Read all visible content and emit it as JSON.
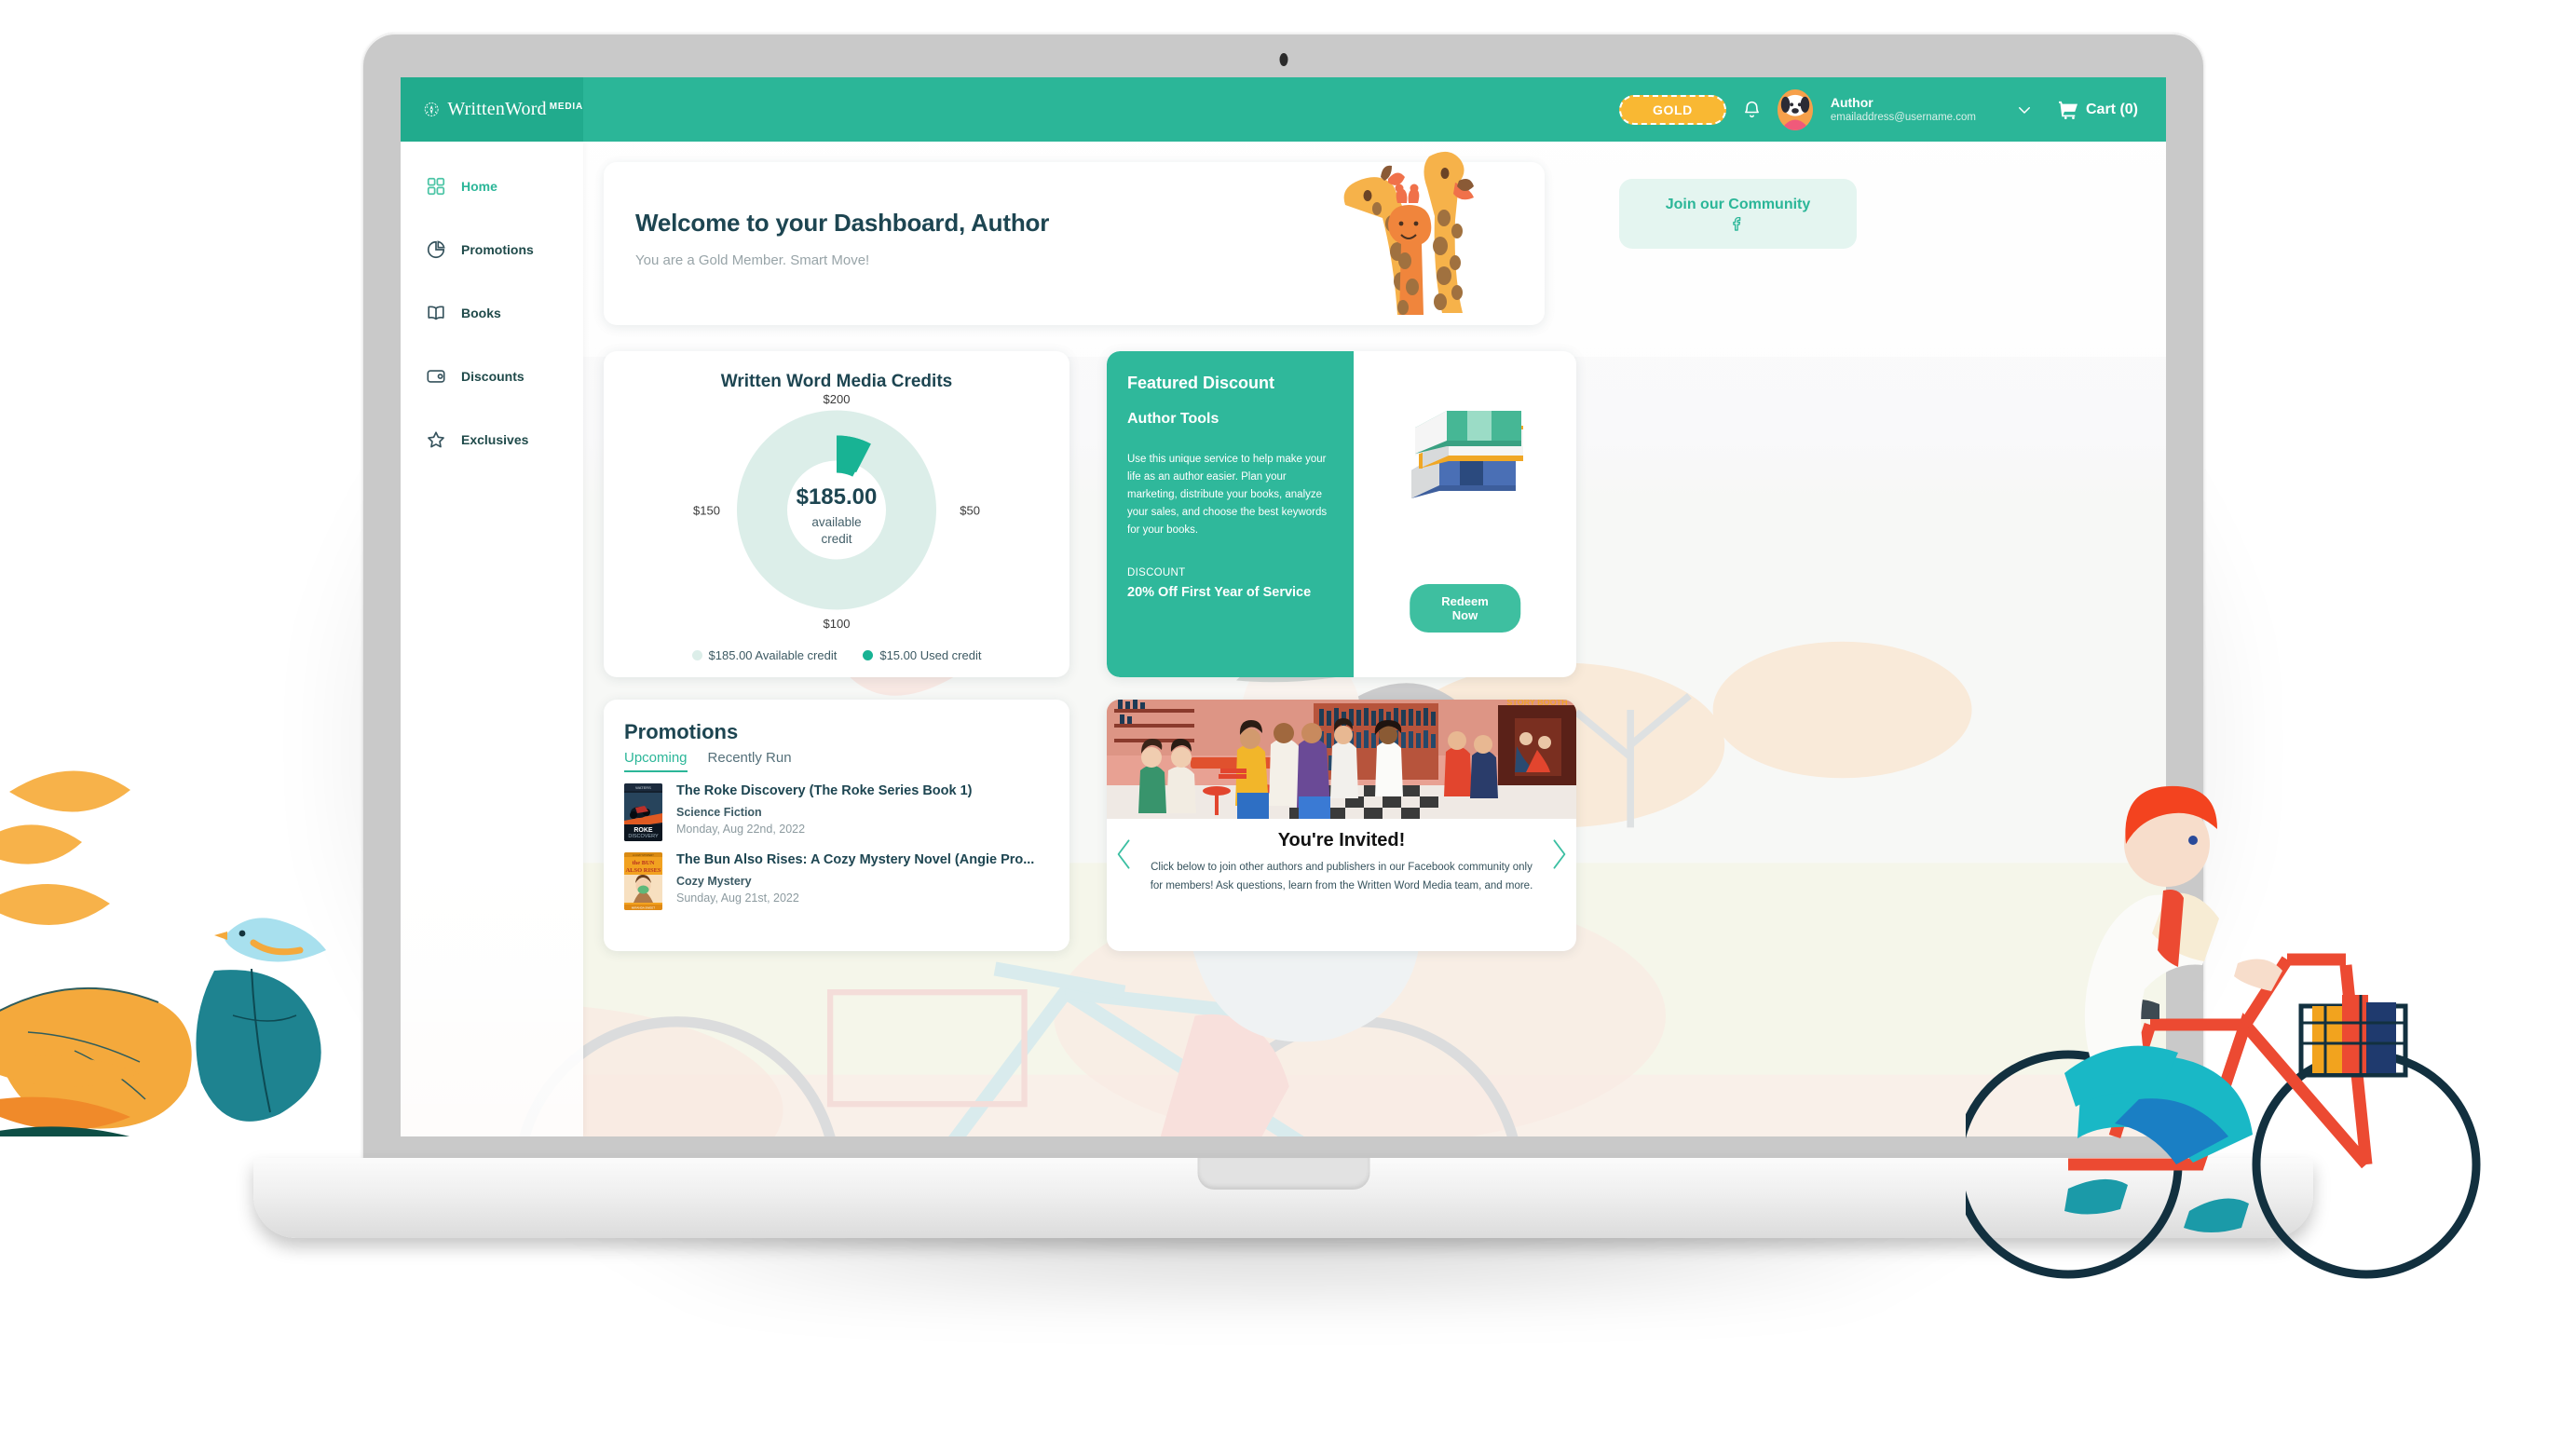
{
  "brand": {
    "name": "WrittenWord",
    "suffix": "MEDIA",
    "mark_icon": "pen-brain-logo-icon"
  },
  "topbar": {
    "membership_badge": "GOLD",
    "bell_icon": "notification-bell-icon",
    "avatar_icon": "user-avatar-dog",
    "user_name": "Author",
    "user_email": "emailaddress@username.com",
    "caret_icon": "chevron-down-icon",
    "cart_icon": "shopping-cart-icon",
    "cart_label": "Cart (0)"
  },
  "sidebar": {
    "items": [
      {
        "label": "Home",
        "icon": "grid-squares-icon",
        "active": true
      },
      {
        "label": "Promotions",
        "icon": "pie-chart-icon",
        "active": false
      },
      {
        "label": "Books",
        "icon": "open-book-icon",
        "active": false
      },
      {
        "label": "Discounts",
        "icon": "wallet-icon",
        "active": false
      },
      {
        "label": "Exclusives",
        "icon": "star-icon",
        "active": false
      }
    ]
  },
  "welcome": {
    "title": "Welcome to your Dashboard, Author",
    "subtitle": "You are a Gold Member. Smart Move!",
    "illustration": "three-giraffes-illustration"
  },
  "community": {
    "label": "Join our Community",
    "icon": "facebook-icon"
  },
  "credits": {
    "title": "Written Word Media Credits",
    "center_amount": "$185.00",
    "center_caption_line1": "available",
    "center_caption_line2": "credit",
    "axis_labels": {
      "top": "$200",
      "right": "$50",
      "bottom": "$100",
      "left": "$150"
    },
    "legend": [
      {
        "label": "$185.00 Available credit",
        "color": "#dceee9"
      },
      {
        "label": "$15.00 Used credit",
        "color": "#18b394"
      }
    ]
  },
  "chart_data": {
    "type": "pie",
    "title": "Written Word Media Credits",
    "labels": [
      "Available credit",
      "Used credit"
    ],
    "values": [
      185.0,
      15.0
    ],
    "colors": [
      "#dceee9",
      "#18b394"
    ],
    "total": 200,
    "units": "USD",
    "center_label": "$185.00 available credit",
    "axis_tick_labels": [
      "$200",
      "$50",
      "$100",
      "$150"
    ],
    "legend_position": "bottom",
    "legend_entries": [
      "$185.00 Available credit",
      "$15.00 Used credit"
    ]
  },
  "discount": {
    "eyebrow": "Featured Discount",
    "name": "Author Tools",
    "body": "Use this unique service to help make your life as an author easier. Plan your marketing, distribute your books, analyze your sales, and choose the best keywords for your books.",
    "kicker": "DISCOUNT",
    "deal": "20% Off First Year of Service",
    "button": "Redeem Now",
    "illustration": "stack-of-books-illustration",
    "accent_color": "#2fb89b"
  },
  "promotions": {
    "title": "Promotions",
    "tabs": [
      {
        "label": "Upcoming",
        "active": true
      },
      {
        "label": "Recently Run",
        "active": false
      }
    ],
    "items": [
      {
        "title": "The Roke Discovery (The Roke Series Book 1)",
        "genre": "Science Fiction",
        "date": "Monday, Aug 22nd, 2022",
        "cover": "roke-discovery-book-cover"
      },
      {
        "title": "The Bun Also Rises: A Cozy Mystery Novel (Angie Pro...",
        "genre": "Cozy Mystery",
        "date": "Sunday, Aug 21st, 2022",
        "cover": "bun-also-rises-book-cover"
      }
    ]
  },
  "invite": {
    "hero_image": "bookstore-cafe-crowd-illustration",
    "title": "You're Invited!",
    "text": "Click below to join other authors and publishers in our Facebook community only for members! Ask questions, learn from the Written Word Media team, and more.",
    "prev_icon": "chevron-left-icon",
    "next_icon": "chevron-right-icon"
  },
  "decor": {
    "left_illustration": "autumn-leaves-and-bird-illustration",
    "right_illustration": "man-on-bicycle-with-books-illustration",
    "screen_background": "woman-cycling-in-park-illustration",
    "device": "laptop-mockup"
  },
  "colors": {
    "brand_teal": "#2bb698",
    "gold": "#f9b833",
    "ink": "#1d4551"
  }
}
